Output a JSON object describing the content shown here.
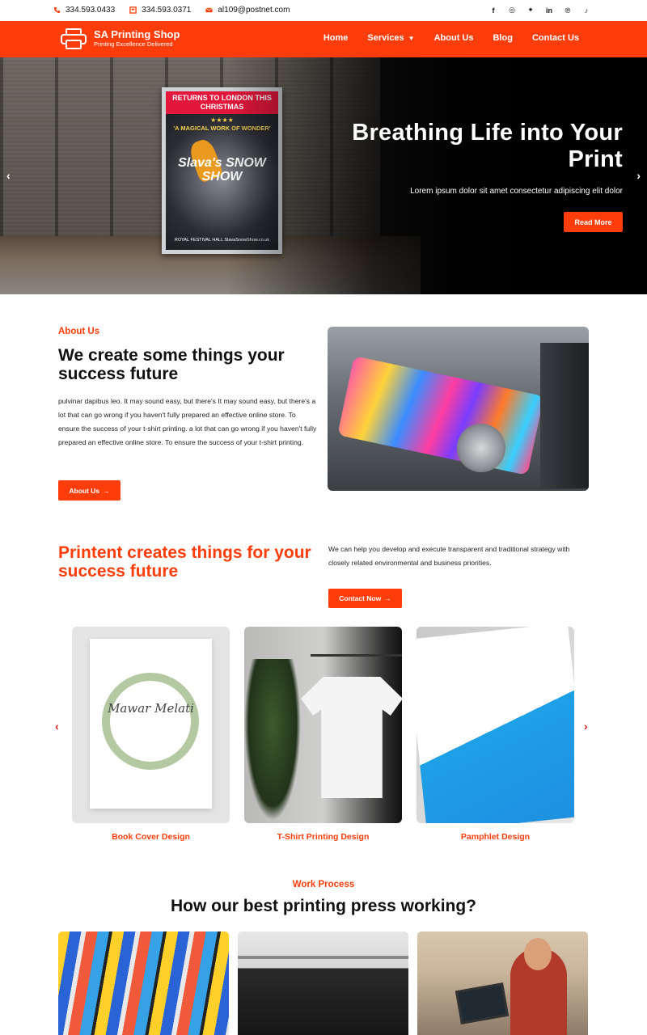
{
  "topbar": {
    "phone1": "334.593.0433",
    "phone2": "334.593.0371",
    "email": "al109@postnet.com",
    "social_icons": [
      "facebook-icon",
      "instagram-icon",
      "twitter-icon",
      "linkedin-icon",
      "pinterest-icon",
      "tiktok-icon"
    ]
  },
  "brand": {
    "name": "SA Printing Shop",
    "tagline": "Printing Excellence Delivered",
    "accent_color": "#ff3d0b"
  },
  "nav": {
    "items": [
      {
        "label": "Home"
      },
      {
        "label": "Services"
      },
      {
        "label": "About Us"
      },
      {
        "label": "Blog"
      },
      {
        "label": "Contact Us"
      }
    ]
  },
  "hero": {
    "poster": {
      "header": "RETURNS TO LONDON THIS CHRISTMAS",
      "stars": "★★★★",
      "tagline": "'A MAGICAL WORK OF WONDER'",
      "title": "Slava's SNOW SHOW",
      "footer": "ROYAL FESTIVAL HALL SlavaSnowShow.co.uk"
    },
    "title": "Breathing Life into Your Print",
    "subtitle": "Lorem ipsum dolor sit amet consectetur adipiscing elit dolor",
    "button": "Read More"
  },
  "about": {
    "tag": "About Us",
    "heading": "We create some things your success future",
    "paragraph": " pulvinar dapibus leo. It may sound easy, but there's It may sound easy, but there's a lot that can go wrong if you haven't fully prepared an effective online store. To ensure the success of your t-shirt printing. a lot that can go wrong if you haven't fully prepared an effective online store. To ensure the success of your t-shirt printing.",
    "button": "About Us"
  },
  "printent": {
    "heading": "Printent creates things for your success future",
    "paragraph": "We can help you develop and execute transparent and traditional strategy with closely related environmental and business priorities.",
    "button": "Contact Now"
  },
  "services": {
    "cards": [
      {
        "title": "Book Cover Design",
        "image_text": "Mawar Melati"
      },
      {
        "title": "T-Shirt Printing Design"
      },
      {
        "title": "Pamphlet Design"
      }
    ]
  },
  "work_process": {
    "tag": "Work Process",
    "heading": "How our best printing press working?"
  }
}
